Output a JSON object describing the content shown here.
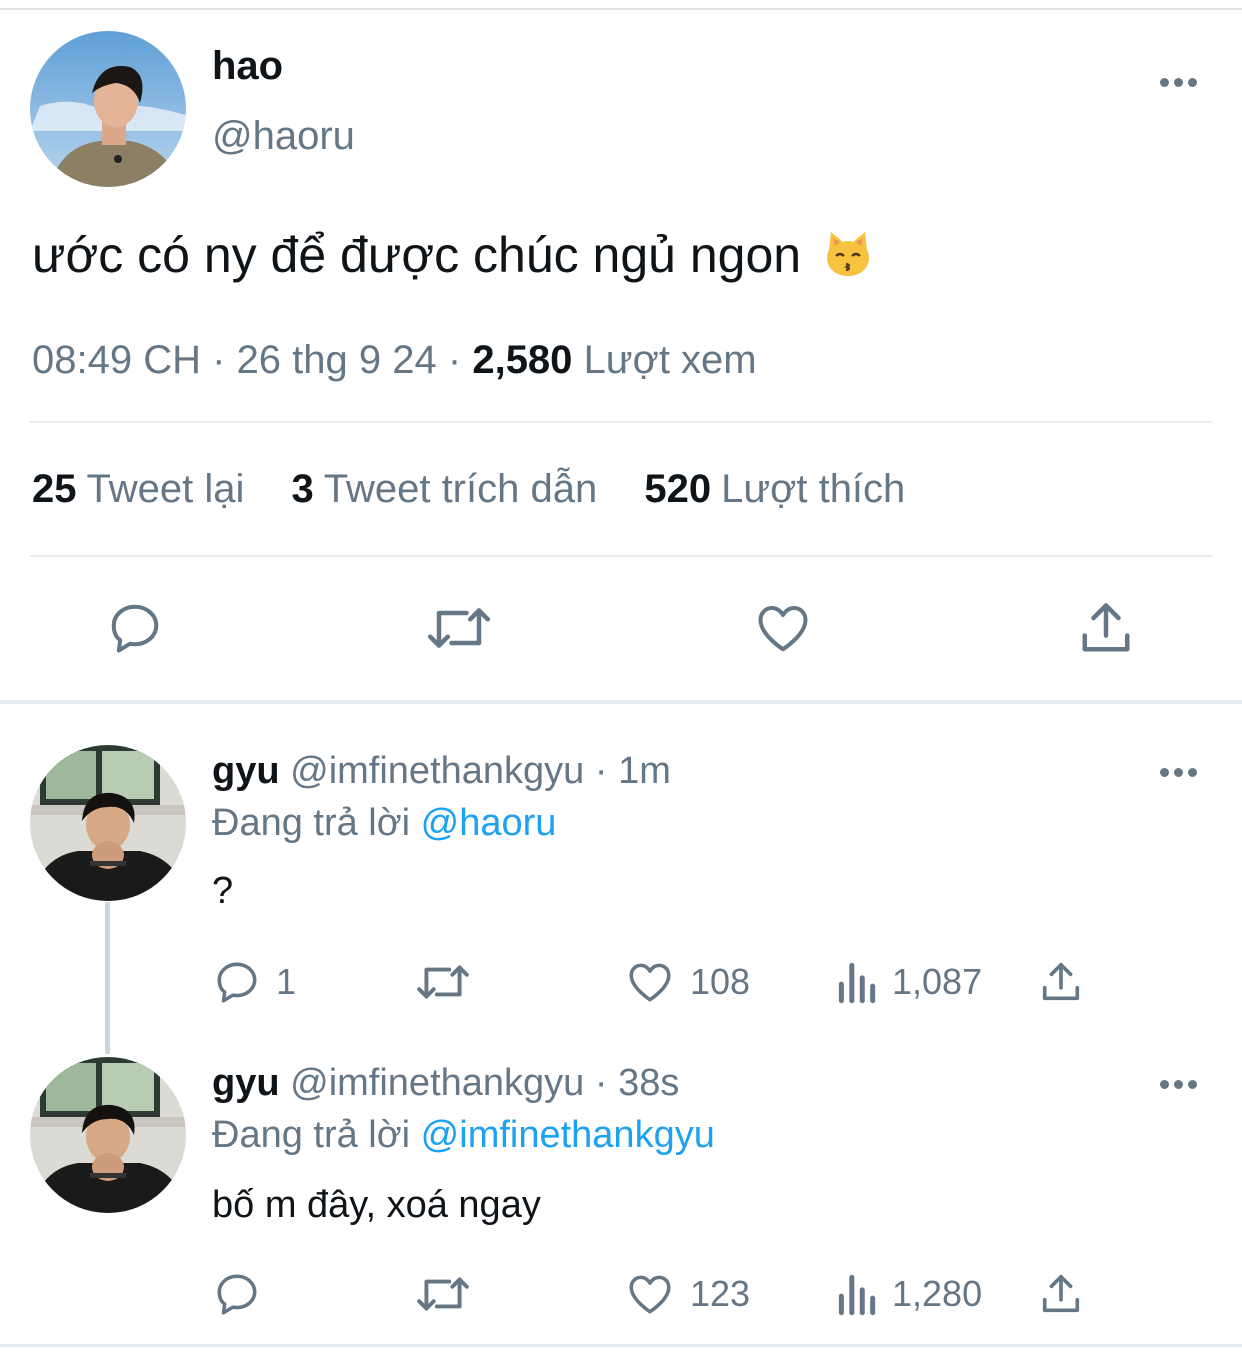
{
  "main_tweet": {
    "name": "hao",
    "handle": "@haoru",
    "text": "ước có ny để được chúc ngủ ngon",
    "emoji": "kissing-cat-emoji",
    "time": "08:49 CH",
    "sep1": "·",
    "date": "26 thg 9 24",
    "sep2": "·",
    "views_count": "2,580",
    "views_label": "Lượt xem",
    "retweets_count": "25",
    "retweets_label": "Tweet lại",
    "quotes_count": "3",
    "quotes_label": "Tweet trích dẫn",
    "likes_count": "520",
    "likes_label": "Lượt thích"
  },
  "replies": [
    {
      "name": "gyu",
      "handle": "@imfinethankgyu",
      "sep": "·",
      "time": "1m",
      "replying_label": "Đang trả lời",
      "replying_to": "@haoru",
      "text": "?",
      "reply_count": "1",
      "retweet_count": "",
      "like_count": "108",
      "view_count": "1,087"
    },
    {
      "name": "gyu",
      "handle": "@imfinethankgyu",
      "sep": "·",
      "time": "38s",
      "replying_label": "Đang trả lời",
      "replying_to": "@imfinethankgyu",
      "text": "bố m đây, xoá ngay",
      "reply_count": "",
      "retweet_count": "",
      "like_count": "123",
      "view_count": "1,280"
    }
  ],
  "colors": {
    "icon_gray": "#657786",
    "text_dark": "#0f1419",
    "mention_blue": "#1da1f2",
    "divider": "#e6ecf0"
  }
}
